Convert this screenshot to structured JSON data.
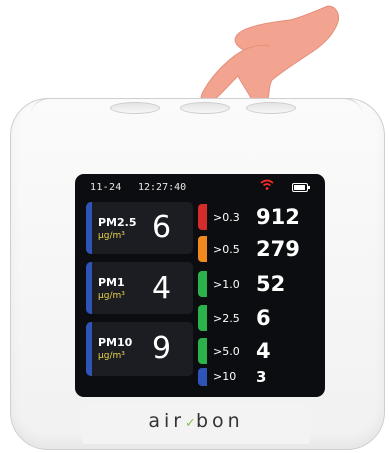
{
  "device": {
    "brand": "air",
    "brand_suffix": "bon",
    "brand_mark": "check"
  },
  "status": {
    "date": "11-24",
    "time": "12:27:40",
    "wifi_icon": "wifi-icon",
    "battery_icon": "battery-icon"
  },
  "pm_cards": [
    {
      "name": "PM2.5",
      "unit": "µg/m³",
      "value": "6"
    },
    {
      "name": "PM1",
      "unit": "µg/m³",
      "value": "4"
    },
    {
      "name": "PM10",
      "unit": "µg/m³",
      "value": "9"
    }
  ],
  "particle_counts": [
    {
      "size": ">0.3",
      "count": "912",
      "color": "#d62b2b"
    },
    {
      "size": ">0.5",
      "count": "279",
      "color": "#f08a1c"
    },
    {
      "size": ">1.0",
      "count": "52",
      "color": "#2bb24a"
    },
    {
      "size": ">2.5",
      "count": "6",
      "color": "#2bb24a"
    },
    {
      "size": ">5.0",
      "count": "4",
      "color": "#2bb24a"
    },
    {
      "size": ">10",
      "count": "3",
      "color": "#2f54b8"
    }
  ],
  "colors": {
    "screen": "#0c0d10",
    "card": "#1b1d22",
    "unit_text": "#e9d24a",
    "pm_bar": "#2f54b8",
    "wifi": "#ff2b2b"
  }
}
